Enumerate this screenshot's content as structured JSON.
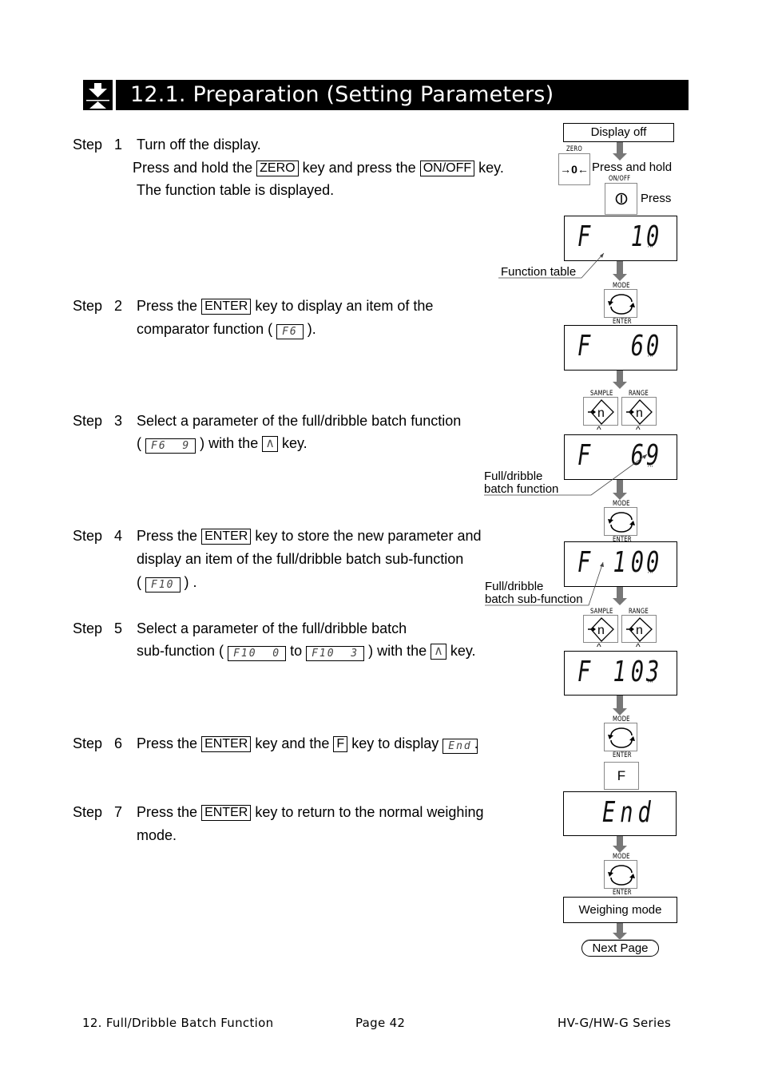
{
  "header": {
    "icon": "down-arrow-on-triangle-icon",
    "title": "12.1.  Preparation (Setting Parameters)"
  },
  "steps": [
    {
      "label": "Step",
      "number": "1",
      "lines": {
        "l1": "Turn off the display.",
        "l2a": "Press and hold the",
        "l2key1": "ZERO",
        "l2b": "key and press the",
        "l2key2": "ON/OFF",
        "l2c": "key.",
        "l3": "The function table is displayed."
      }
    },
    {
      "label": "Step",
      "number": "2",
      "lines": {
        "l1a": "Press the",
        "l1key": "ENTER",
        "l1b": "key to display an item of the",
        "l2a": "comparator function (",
        "l2lcd": "F6",
        "l2b": ")."
      }
    },
    {
      "label": "Step",
      "number": "3",
      "lines": {
        "l1": "Select a parameter of the full/dribble batch function",
        "l2a": "(",
        "l2lcd": "F6  9",
        "l2b": ") with the",
        "l2key": "∧",
        "l2c": "key."
      }
    },
    {
      "label": "Step",
      "number": "4",
      "lines": {
        "l1a": "Press the",
        "l1key": "ENTER",
        "l1b": "key to store the new parameter and",
        "l2": "display an item of the full/dribble batch sub-function",
        "l3a": "(",
        "l3lcd": "F10",
        "l3b": ") ."
      }
    },
    {
      "label": "Step",
      "number": "5",
      "lines": {
        "l1": "Select a parameter of the full/dribble batch",
        "l2a": "sub-function (",
        "l2lcd1": "F10  0",
        "l2b": "to",
        "l2lcd2": "F10  3",
        "l2c": ") with the",
        "l2key": "∧",
        "l2d": "key."
      }
    },
    {
      "label": "Step",
      "number": "6",
      "lines": {
        "l1a": "Press the",
        "l1key1": "ENTER",
        "l1b": "key and the",
        "l1key2": "F",
        "l1c": "key to display",
        "l1lcd": "End",
        "l1d": "."
      }
    },
    {
      "label": "Step",
      "number": "7",
      "lines": {
        "l1a": "Press the",
        "l1key": "ENTER",
        "l1b": "key to return to the normal weighing",
        "l2": "mode."
      }
    }
  ],
  "diagram": {
    "display_off": "Display off",
    "zero_key_label": "ZERO",
    "zero_key_glyph": "→0←",
    "press_and_hold": "Press and hold",
    "onoff_key_label": "ON/OFF",
    "onoff_key_glyph": "⏀",
    "press": "Press",
    "lcd1": {
      "left": "F  1",
      "right": "0"
    },
    "callout_function_table": "Function table",
    "mode_label": "MODE",
    "enter_label": "ENTER",
    "lcd2": {
      "left": "F  6",
      "right": "0"
    },
    "sample_label": "SAMPLE",
    "range_label": "RANGE",
    "sample_glyph": "→n",
    "caret": "^",
    "lcd3": {
      "left": "F  6",
      "right": "9"
    },
    "callout_batch_function": [
      "Full/dribble",
      "batch function"
    ],
    "lcd4": {
      "left": "F 10",
      "right": "0"
    },
    "callout_batch_subfunction": [
      "Full/dribble",
      "batch sub-function"
    ],
    "lcd5": {
      "left": "F 10",
      "right": "3"
    },
    "f_key": "F",
    "lcd6": "End",
    "weighing_mode": "Weighing mode",
    "next_page": "Next Page",
    "blink_marks": "'''"
  },
  "footer": {
    "section": "12. Full/Dribble Batch Function",
    "page": "Page 42",
    "series": "HV-G/HW-G Series"
  }
}
